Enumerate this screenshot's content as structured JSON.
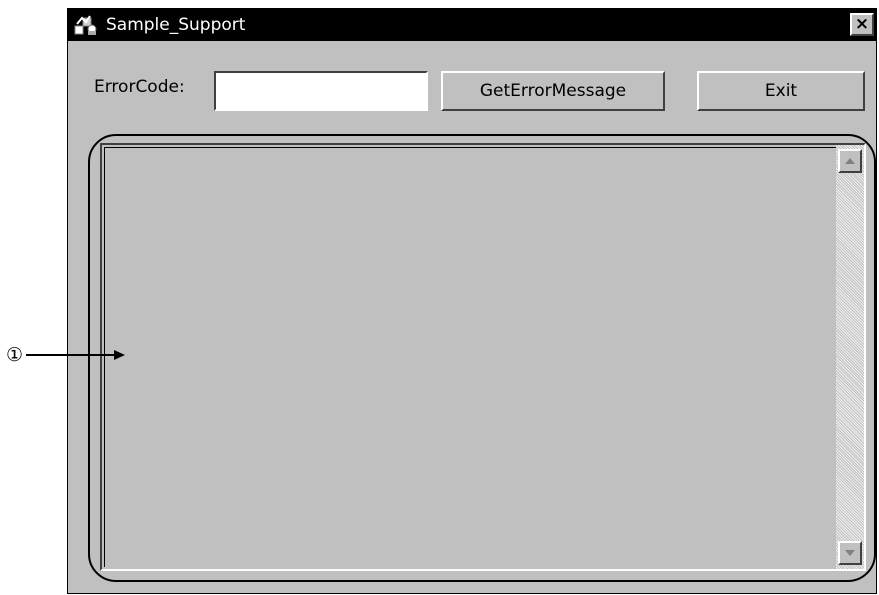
{
  "window": {
    "title": "Sample_Support",
    "close_symbol": "×",
    "icon": "app-icon"
  },
  "form": {
    "errorcode_label": "ErrorCode:",
    "errorcode_value": "",
    "get_button_label": "GetErrorMessage",
    "exit_button_label": "Exit"
  },
  "listbox": {
    "items": [],
    "scroll_up_icon": "scroll-up-arrow-icon",
    "scroll_down_icon": "scroll-down-arrow-icon"
  },
  "callout": {
    "label": "①"
  },
  "colors": {
    "window_bg": "#c0c0c0",
    "titlebar_bg": "#000000",
    "titlebar_text": "#ffffff"
  }
}
